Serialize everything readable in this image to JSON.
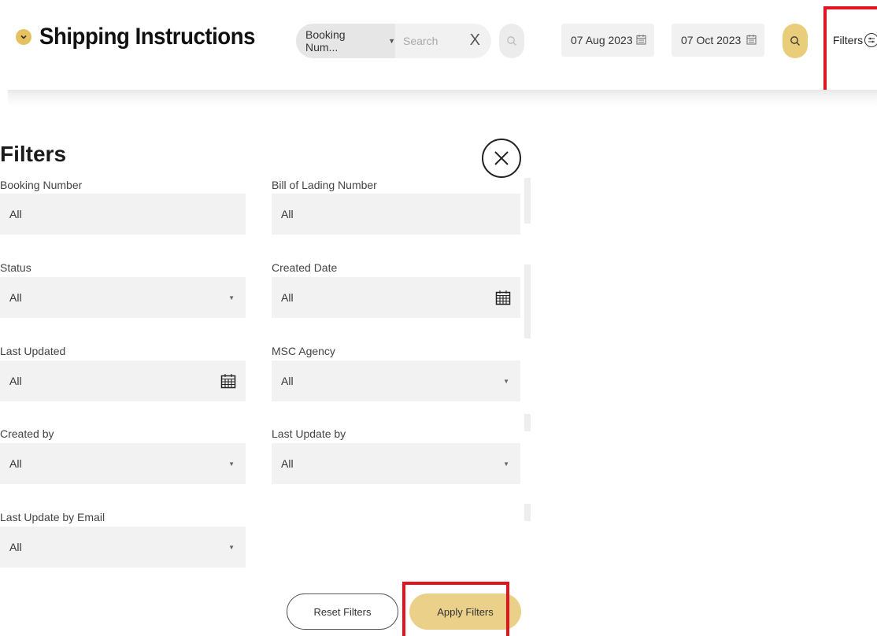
{
  "header": {
    "title": "Shipping Instructions",
    "search": {
      "field_selected": "Booking Num...",
      "placeholder": "Search",
      "clear_symbol": "X"
    },
    "date_from": "07 Aug 2023",
    "date_to": "07 Oct 2023",
    "filters_label": "Filters"
  },
  "filters_panel": {
    "title": "Filters",
    "fields": {
      "booking_number": {
        "label": "Booking Number",
        "value": "All"
      },
      "bill_of_lading_number": {
        "label": "Bill of Lading Number",
        "value": "All"
      },
      "status": {
        "label": "Status",
        "value": "All"
      },
      "created_date": {
        "label": "Created Date",
        "value": "All"
      },
      "last_updated": {
        "label": "Last Updated",
        "value": "All"
      },
      "msc_agency": {
        "label": "MSC Agency",
        "value": "All"
      },
      "created_by": {
        "label": "Created by",
        "value": "All"
      },
      "last_update_by": {
        "label": "Last Update by",
        "value": "All"
      },
      "last_update_by_email": {
        "label": "Last Update by Email",
        "value": "All"
      }
    },
    "reset_label": "Reset Filters",
    "apply_label": "Apply Filters"
  },
  "icons": {
    "title_toggle": "chevron-down-icon",
    "search": "search-icon",
    "calendar": "calendar-icon",
    "filters": "filter-sliders-icon",
    "close": "close-icon"
  },
  "colors": {
    "accent_gold": "#e9cd7a",
    "highlight_red": "#e0151f",
    "field_bg": "#f2f2f2"
  }
}
